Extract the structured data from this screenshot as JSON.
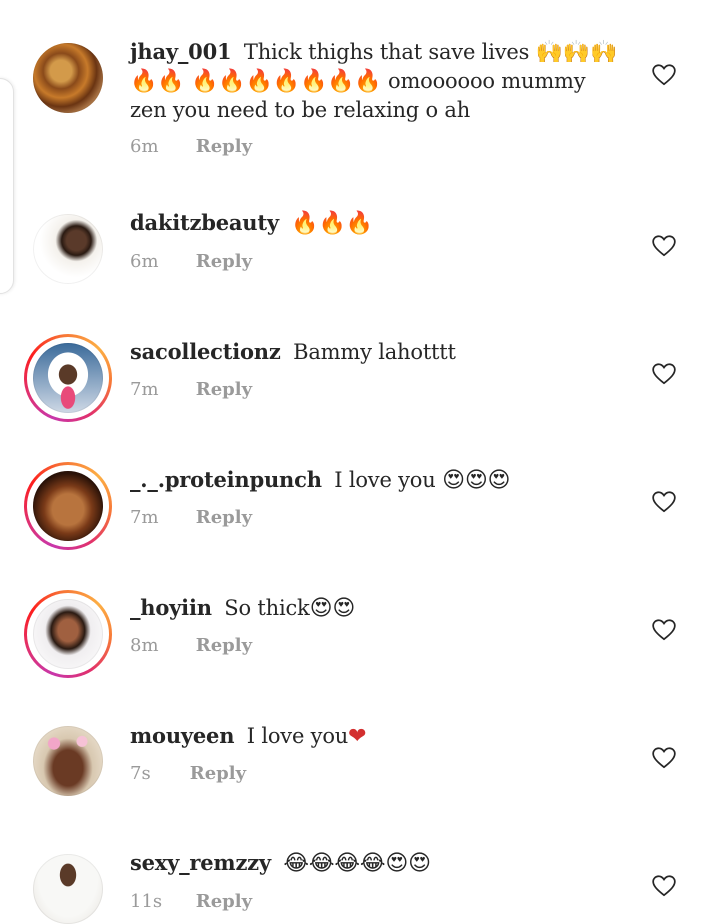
{
  "comments": [
    {
      "username": "jhay_001",
      "text": "Thick thighs that save lives",
      "emoji": "🙌🙌🙌🔥🔥 🔥🔥🔥🔥🔥🔥🔥",
      "text2": "omoooooo mummy zen you need to be relaxing o ah",
      "time": "6m",
      "reply": "Reply",
      "avatar": "plantain-photo"
    },
    {
      "username": "dakitzbeauty",
      "text": "",
      "emoji": "🔥🔥🔥",
      "text2": "",
      "time": "6m",
      "reply": "Reply",
      "avatar": "beauty-ad-photo"
    },
    {
      "username": "sacollectionz",
      "text": "Bammy lahotttt",
      "emoji": "",
      "text2": "",
      "time": "7m",
      "reply": "Reply",
      "avatar": "bride-photo"
    },
    {
      "username": "_._.proteinpunch",
      "text": "I love you",
      "emoji": "😍😍😍",
      "text2": "",
      "time": "7m",
      "reply": "Reply",
      "avatar": "selfie-photo"
    },
    {
      "username": "_hoyiin",
      "text": "So thick",
      "emoji": "😍😍",
      "text2": "",
      "time": "8m",
      "reply": "Reply",
      "avatar": "portrait-photo"
    },
    {
      "username": "mouyeen",
      "text": "I love you",
      "emoji": "❤",
      "text2": "",
      "time": "7s",
      "reply": "Reply",
      "avatar": "flower-crown-photo"
    },
    {
      "username": "sexy_remzzy",
      "text": "",
      "emoji": "😂😂😂😂😍😍",
      "text2": "",
      "time": "11s",
      "reply": "Reply",
      "avatar": "tshirt-photo"
    }
  ],
  "icons": {
    "like": "heart-outline-icon"
  },
  "colors": {
    "heart_stroke": "#262626",
    "meta_text": "#9a9a9a",
    "story_ring": "#e1306c"
  }
}
